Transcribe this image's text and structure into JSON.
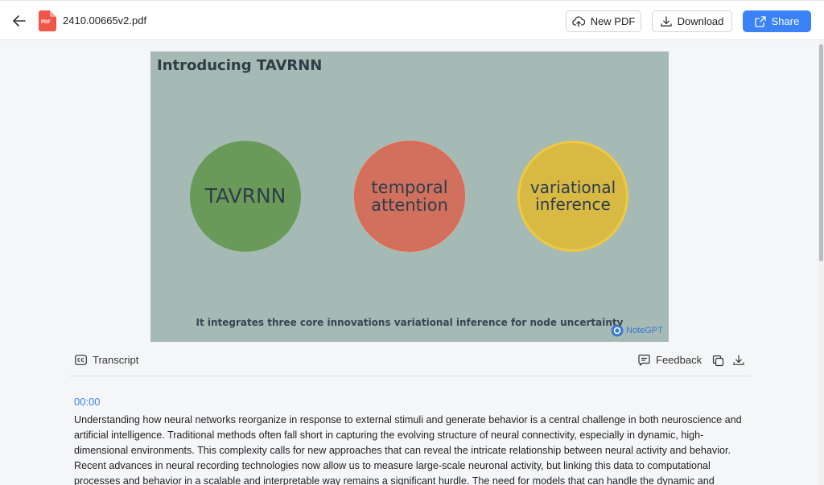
{
  "header": {
    "filename": "2410.00665v2.pdf",
    "pdf_badge": "PDF",
    "new_pdf_label": "New PDF",
    "download_label": "Download",
    "share_label": "Share"
  },
  "slide": {
    "title": "Introducing TAVRNN",
    "circles": [
      {
        "label": "TAVRNN",
        "color": "#6a9a5a"
      },
      {
        "label": "temporal attention",
        "color": "#d2705e"
      },
      {
        "label": "variational inference",
        "color": "#d8b944"
      }
    ],
    "caption": "It integrates three core innovations variational inference for node uncertainty",
    "watermark": "NoteGPT",
    "background": "#a5bab4"
  },
  "transcript_bar": {
    "transcript_label": "Transcript",
    "feedback_label": "Feedback"
  },
  "transcript": {
    "timestamp": "00:00",
    "text": "Understanding how neural networks reorganize in response to external stimuli and generate behavior is a central challenge in both neuroscience and artificial intelligence. Traditional methods often fall short in capturing the evolving structure of neural connectivity, especially in dynamic, high-dimensional environments. This complexity calls for new approaches that can reveal the intricate relationship between neural activity and behavior. Recent advances in neural recording technologies now allow us to measure large-scale neuronal activity, but linking this data to computational processes and behavior in a scalable and interpretable way remains a significant hurdle. The need for models that can handle the dynamic and uncertain nature of neural systems has never been greater. In this context,"
  },
  "colors": {
    "accent": "#3b82f6"
  }
}
